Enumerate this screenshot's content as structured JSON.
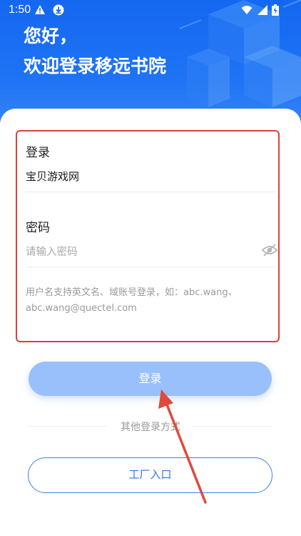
{
  "status_bar": {
    "time": "1:50",
    "icons": [
      "alert-icon",
      "download-icon",
      "wifi-icon",
      "signal-icon",
      "battery-icon"
    ]
  },
  "header": {
    "greeting_line1": "您好，",
    "greeting_line2": "欢迎登录移远书院"
  },
  "form": {
    "account_label": "登录",
    "account_value": "宝贝游戏网",
    "password_label": "密码",
    "password_placeholder": "请输入密码",
    "hint": "用户名支持英文名、域账号登录，如：abc.wang、abc.wang@quectel.com"
  },
  "actions": {
    "login_label": "登录",
    "other_methods_label": "其他登录方式",
    "factory_label": "工厂入口"
  },
  "colors": {
    "brand_blue": "#1467f0",
    "login_button": "#99c0fb",
    "highlight_red": "#d8413d"
  }
}
